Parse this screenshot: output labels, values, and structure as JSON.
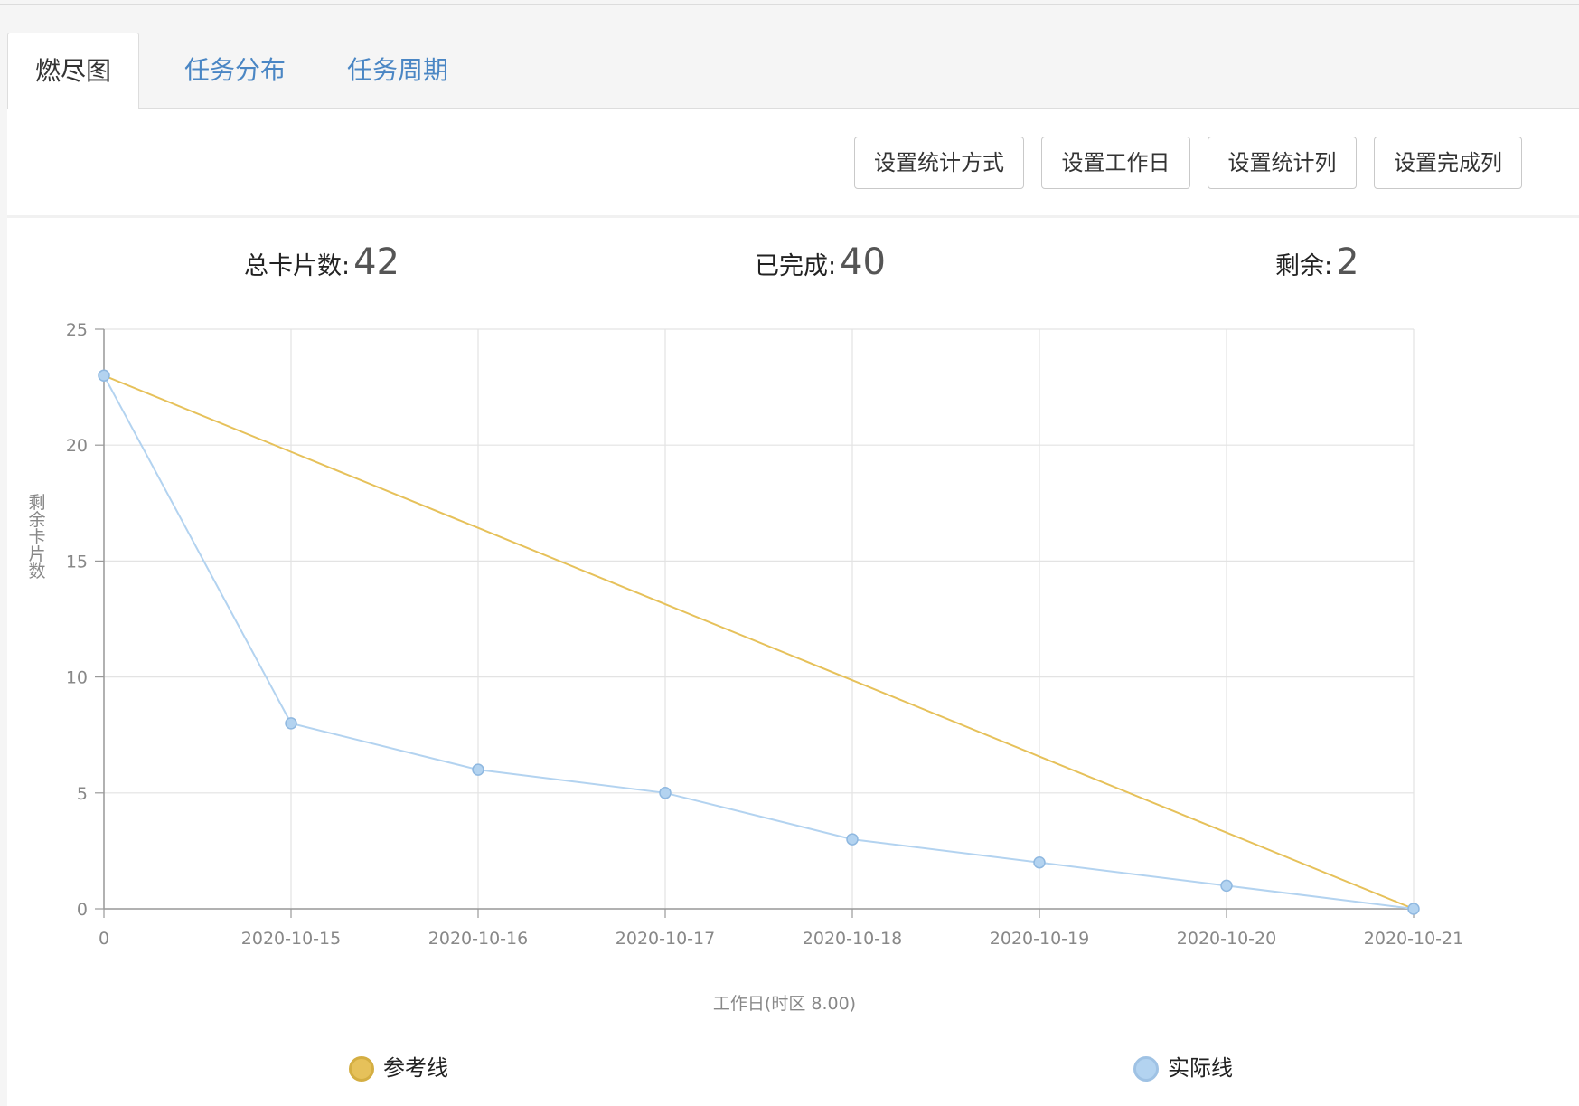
{
  "tabs": [
    {
      "label": "燃尽图",
      "active": true
    },
    {
      "label": "任务分布",
      "active": false
    },
    {
      "label": "任务周期",
      "active": false
    }
  ],
  "toolbar": {
    "buttons": [
      "设置统计方式",
      "设置工作日",
      "设置统计列",
      "设置完成列"
    ]
  },
  "stats": {
    "total_label": "总卡片数:",
    "total_value": "42",
    "done_label": "已完成:",
    "done_value": "40",
    "remain_label": "剩余:",
    "remain_value": "2"
  },
  "chart_data": {
    "type": "line",
    "x": [
      "0",
      "2020-10-15",
      "2020-10-16",
      "2020-10-17",
      "2020-10-18",
      "2020-10-19",
      "2020-10-20",
      "2020-10-21"
    ],
    "series": [
      {
        "name": "参考线",
        "color": "#e6c15a",
        "values": [
          23,
          19.71,
          16.43,
          13.14,
          9.86,
          6.57,
          3.29,
          0
        ],
        "markers": false
      },
      {
        "name": "实际线",
        "color": "#b3d3f0",
        "values": [
          23,
          8,
          6,
          5,
          3,
          2,
          1,
          0
        ],
        "markers": true
      }
    ],
    "ylabel": "剩余卡片数",
    "xlabel": "工作日(时区 8.00)",
    "ylim": [
      0,
      25
    ],
    "yticks": [
      0,
      5,
      10,
      15,
      20,
      25
    ],
    "grid": true,
    "legend": "bottom"
  }
}
